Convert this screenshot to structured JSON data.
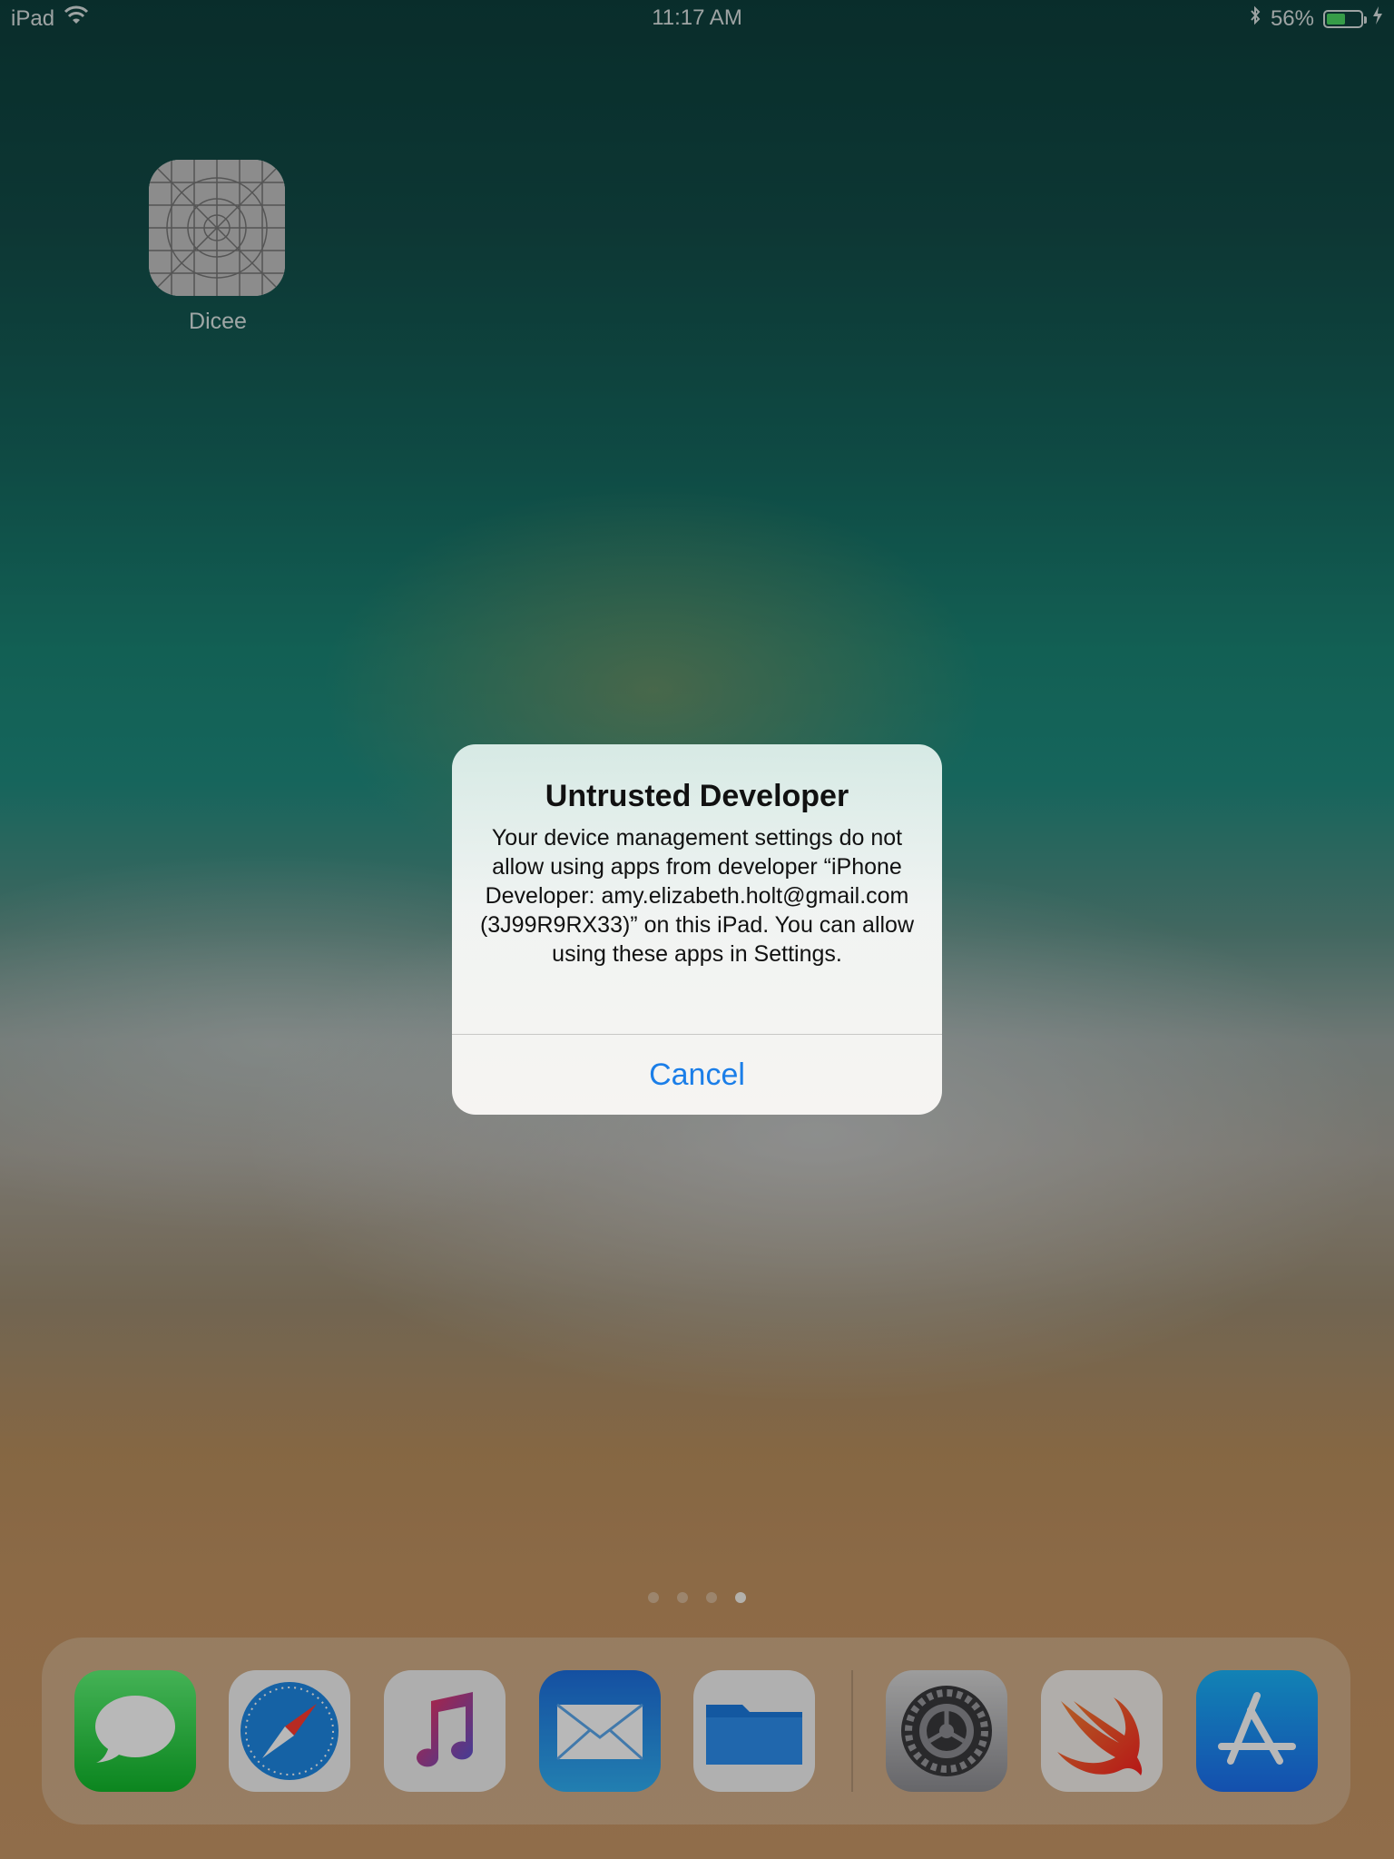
{
  "status_bar": {
    "device": "iPad",
    "time": "11:17 AM",
    "battery_percent": "56%",
    "battery_level": 0.56,
    "icons": [
      "wifi-icon",
      "bluetooth-icon",
      "battery-icon",
      "charging-bolt-icon"
    ]
  },
  "home_screen": {
    "apps": [
      {
        "label": "Dicee",
        "icon": "placeholder-grid-icon"
      }
    ],
    "page_dots": {
      "count": 4,
      "active_index": 3
    }
  },
  "dock": {
    "apps": [
      {
        "name": "Messages",
        "icon": "messages-icon"
      },
      {
        "name": "Safari",
        "icon": "safari-icon"
      },
      {
        "name": "Music",
        "icon": "music-icon"
      },
      {
        "name": "Mail",
        "icon": "mail-icon"
      },
      {
        "name": "Files",
        "icon": "files-icon"
      },
      {
        "name": "Settings",
        "icon": "settings-icon"
      },
      {
        "name": "Swift Playgrounds",
        "icon": "swift-icon"
      },
      {
        "name": "App Store",
        "icon": "app-store-icon"
      }
    ]
  },
  "alert": {
    "title": "Untrusted Developer",
    "message": "Your device management settings do not allow using apps from developer “iPhone Developer: amy.elizabeth.holt@gmail.com (3J99R9RX33)” on this iPad. You can allow using these apps in Settings.",
    "cancel_label": "Cancel",
    "accent_color": "#1b7ee8"
  }
}
